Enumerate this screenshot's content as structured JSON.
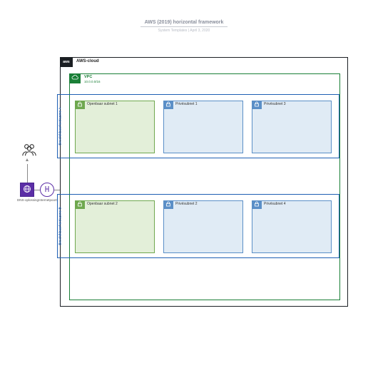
{
  "header": {
    "title": "AWS (2019) horizontal framework",
    "subtitle": "System Templates  |  April 3, 2020"
  },
  "actors": {
    "users_label": "",
    "dns_label": "DNS-oplossing",
    "igw_label": "Internetpoort"
  },
  "cloud": {
    "tab": "aws",
    "label": "AWS-cloud"
  },
  "vpc": {
    "label": "VPC",
    "cidr": "10.0.0.0/16"
  },
  "azs": [
    {
      "label": "Beschikbaarheidszone A",
      "subnets": [
        {
          "kind": "public",
          "label": "Openbaar subnet 1"
        },
        {
          "kind": "private",
          "label": "Privésubnet 1"
        },
        {
          "kind": "private",
          "label": "Privésubnet 3"
        }
      ]
    },
    {
      "label": "Beschikbaarheidszone B",
      "subnets": [
        {
          "kind": "public",
          "label": "Openbaar subnet 2"
        },
        {
          "kind": "private",
          "label": "Privésubnet 2"
        },
        {
          "kind": "private",
          "label": "Privésubnet 4"
        }
      ]
    }
  ],
  "colors": {
    "cloud_border": "#1b1f23",
    "vpc_green": "#1a7f37",
    "az_blue": "#1e5fb3",
    "public_fill": "#e3efd9",
    "public_border": "#6fa84f",
    "private_fill": "#e0ebf5",
    "private_border": "#5b8fc7",
    "purple": "#5b2ea6"
  }
}
